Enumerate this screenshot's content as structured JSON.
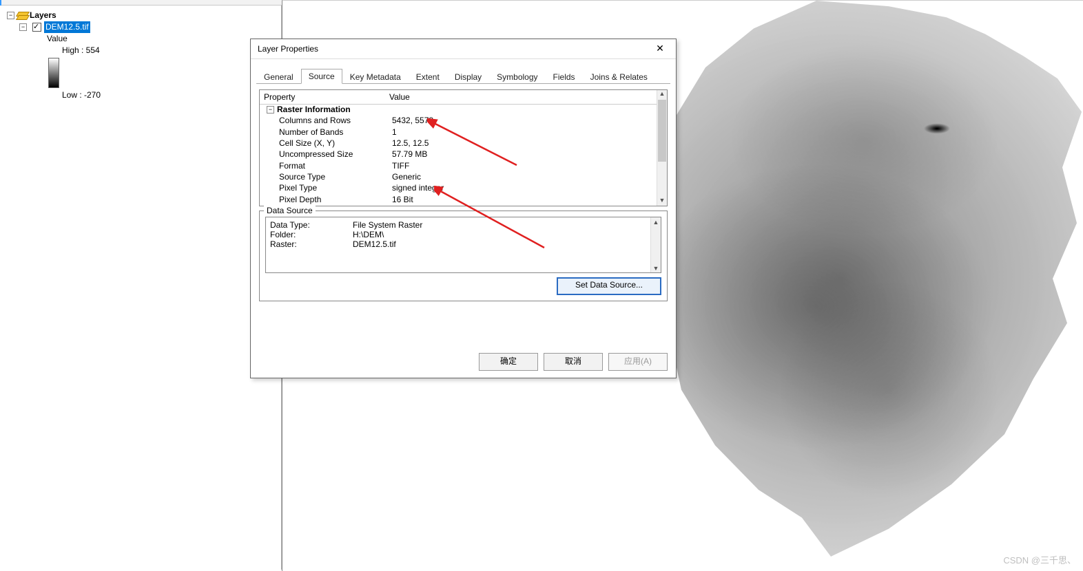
{
  "toc": {
    "title": "Layers",
    "layer_name": "DEM12.5.tif",
    "value_label": "Value",
    "high_label": "High : 554",
    "low_label": "Low : -270"
  },
  "dialog": {
    "title": "Layer Properties",
    "tabs": [
      "General",
      "Source",
      "Key Metadata",
      "Extent",
      "Display",
      "Symbology",
      "Fields",
      "Joins & Relates"
    ],
    "active_tab_index": 1,
    "prop_header_col1": "Property",
    "prop_header_col2": "Value",
    "group_name": "Raster Information",
    "properties": [
      {
        "name": "Columns and Rows",
        "value": "5432, 5578"
      },
      {
        "name": "Number of Bands",
        "value": "1"
      },
      {
        "name": "Cell Size (X, Y)",
        "value": "12.5, 12.5"
      },
      {
        "name": "Uncompressed Size",
        "value": "57.79 MB"
      },
      {
        "name": "Format",
        "value": "TIFF"
      },
      {
        "name": "Source Type",
        "value": "Generic"
      },
      {
        "name": "Pixel Type",
        "value": "signed integer"
      },
      {
        "name": "Pixel Depth",
        "value": "16 Bit"
      }
    ],
    "data_source": {
      "legend": "Data Source",
      "rows": [
        {
          "k": "Data Type:",
          "v": "File System Raster"
        },
        {
          "k": "Folder:",
          "v": "H:\\DEM\\"
        },
        {
          "k": "Raster:",
          "v": "DEM12.5.tif"
        }
      ],
      "set_button": "Set Data Source..."
    },
    "buttons": {
      "ok": "确定",
      "cancel": "取消",
      "apply": "应用(A)"
    }
  },
  "watermark": "CSDN @三千思、"
}
